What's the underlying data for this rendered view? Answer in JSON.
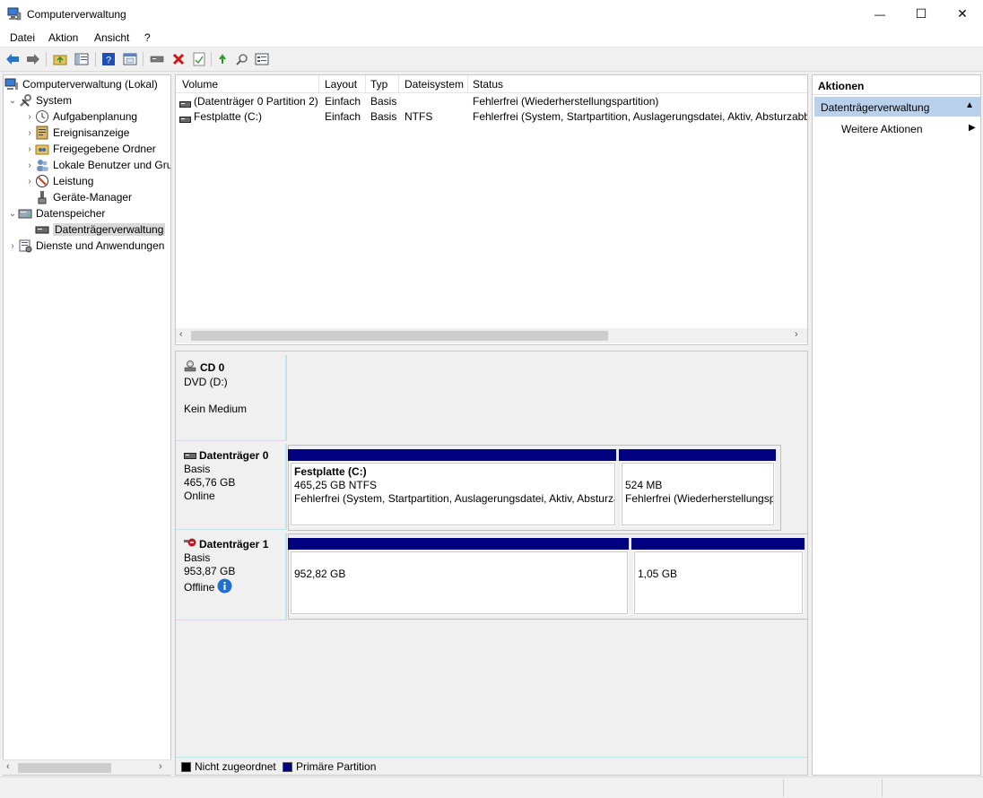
{
  "window": {
    "title": "Computerverwaltung",
    "minimize_glyph": "—",
    "maximize_glyph": "☐",
    "close_glyph": "✕"
  },
  "menu": [
    {
      "label": "Datei"
    },
    {
      "label": "Aktion"
    },
    {
      "label": "Ansicht"
    },
    {
      "label": "?"
    }
  ],
  "toolbar": {
    "icons": [
      "back-arrow-icon",
      "forward-arrow-icon",
      "up-folder-icon",
      "show-hide-tree-icon",
      "help-icon",
      "export-list-icon",
      "connect-drive-icon",
      "delete-icon",
      "properties-icon",
      "refresh-icon",
      "search-icon",
      "settings-icon"
    ]
  },
  "tree": {
    "root": "Computerverwaltung (Lokal)",
    "system": "System",
    "aufgaben": "Aufgabenplanung",
    "ereignis": "Ereignisanzeige",
    "freigabe": "Freigegebene Ordner",
    "benutzer": "Lokale Benutzer und Gruppen",
    "leistung": "Leistung",
    "geraete": "Geräte-Manager",
    "datenspeicher": "Datenspeicher",
    "datentraeger": "Datenträgerverwaltung",
    "dienste": "Dienste und Anwendungen"
  },
  "volume_list": {
    "columns": [
      "Volume",
      "Layout",
      "Typ",
      "Dateisystem",
      "Status"
    ],
    "rows": [
      {
        "volume": "(Datenträger 0 Partition 2)",
        "layout": "Einfach",
        "typ": "Basis",
        "dateisystem": "",
        "status": "Fehlerfrei (Wiederherstellungspartition)"
      },
      {
        "volume": "Festplatte (C:)",
        "layout": "Einfach",
        "typ": "Basis",
        "dateisystem": "NTFS",
        "status": "Fehlerfrei (System, Startpartition, Auslagerungsdatei, Aktiv, Absturzabbild, Primäre Partition)"
      }
    ]
  },
  "disks": {
    "cd0": {
      "name": "CD 0",
      "type": "DVD (D:)",
      "state": "Kein Medium"
    },
    "disk0": {
      "name": "Datenträger 0",
      "type": "Basis",
      "size": "465,76 GB",
      "state": "Online",
      "p1": {
        "title": "Festplatte  (C:)",
        "size": "465,25 GB NTFS",
        "status": "Fehlerfrei (System, Startpartition, Auslagerungsdatei, Aktiv, Absturzabbild)"
      },
      "p2": {
        "size": "524 MB",
        "status": "Fehlerfrei (Wiederherstellungspartition)"
      }
    },
    "disk1": {
      "name": "Datenträger 1",
      "type": "Basis",
      "size": "953,87 GB",
      "state": "Offline",
      "p1": {
        "size": "952,82 GB"
      },
      "p2": {
        "size": "1,05 GB"
      }
    }
  },
  "legend": {
    "unallocated": "Nicht zugeordnet",
    "primary": "Primäre Partition",
    "unallocated_color": "#000000",
    "primary_color": "#000080"
  },
  "actions": {
    "title": "Aktionen",
    "section": "Datenträgerverwaltung",
    "more": "Weitere Aktionen"
  }
}
